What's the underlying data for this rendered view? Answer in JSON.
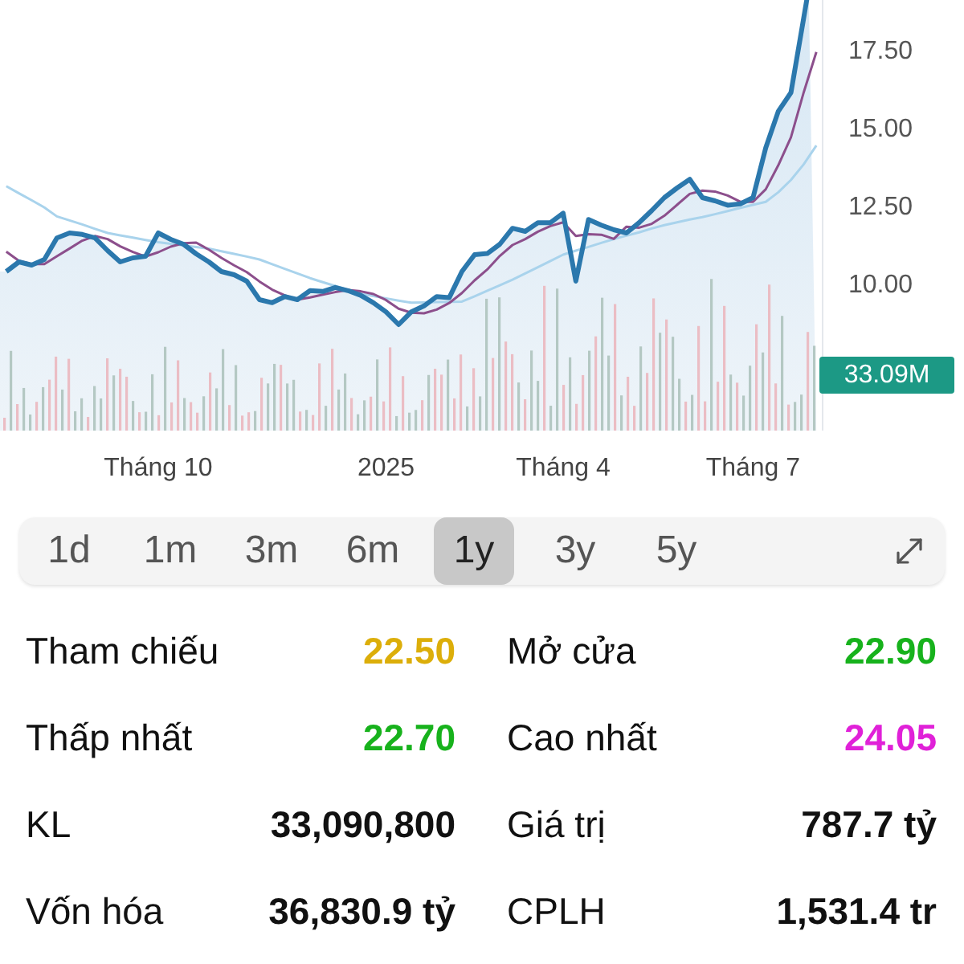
{
  "chart": {
    "volume_badge": "33.09M",
    "chart_data": {
      "type": "line",
      "ylim": [
        5.26,
        19.07
      ],
      "categories": [
        null,
        null,
        null,
        null,
        null,
        null,
        null,
        null,
        null,
        null,
        null,
        null,
        "Tháng 10",
        null,
        null,
        null,
        null,
        null,
        null,
        null,
        null,
        null,
        null,
        null,
        null,
        null,
        null,
        null,
        null,
        null,
        "2025",
        null,
        null,
        null,
        null,
        null,
        null,
        null,
        null,
        null,
        null,
        null,
        null,
        null,
        "Tháng 4",
        null,
        null,
        null,
        null,
        null,
        null,
        null,
        null,
        null,
        null,
        null,
        null,
        null,
        null,
        "Tháng 7",
        null,
        null,
        null,
        null,
        null
      ],
      "yticks": [
        {
          "value": 10,
          "label": "10.00"
        },
        {
          "value": 12.5,
          "label": "12.50"
        },
        {
          "value": 15,
          "label": "15.00"
        },
        {
          "value": 17.5,
          "label": "17.50"
        }
      ],
      "series": [
        {
          "color": "#a9d3ec",
          "values": [
            13.1,
            12.87,
            12.65,
            12.42,
            12.13,
            12.0,
            11.87,
            11.73,
            11.6,
            11.52,
            11.45,
            11.37,
            11.3,
            11.25,
            11.2,
            11.15,
            11.1,
            11.01,
            10.93,
            10.84,
            10.75,
            10.6,
            10.45,
            10.3,
            10.15,
            10.02,
            9.9,
            9.77,
            9.65,
            9.58,
            9.5,
            9.43,
            9.36,
            9.37,
            9.38,
            9.39,
            9.4,
            9.57,
            9.75,
            9.92,
            10.1,
            10.3,
            10.5,
            10.7,
            10.9,
            11.03,
            11.15,
            11.28,
            11.4,
            11.51,
            11.62,
            11.74,
            11.85,
            11.94,
            12.03,
            12.11,
            12.2,
            12.3,
            12.4,
            12.5,
            12.6,
            12.9,
            13.3,
            13.8,
            14.4
          ]
        },
        {
          "color": "#8c4f8c",
          "values": [
            11.0,
            10.7,
            10.6,
            10.6,
            10.85,
            11.1,
            11.35,
            11.5,
            11.4,
            11.17,
            10.99,
            10.84,
            10.98,
            11.16,
            11.27,
            11.29,
            11.06,
            10.8,
            10.56,
            10.34,
            10.04,
            9.78,
            9.6,
            9.46,
            9.53,
            9.62,
            9.7,
            9.77,
            9.73,
            9.64,
            9.45,
            9.17,
            9.04,
            9.02,
            9.14,
            9.35,
            9.67,
            10.08,
            10.43,
            10.86,
            11.21,
            11.4,
            11.64,
            11.82,
            11.94,
            11.5,
            11.56,
            11.54,
            11.41,
            11.8,
            11.77,
            11.89,
            12.15,
            12.5,
            12.85,
            12.96,
            12.93,
            12.8,
            12.6,
            12.6,
            13.0,
            13.77,
            14.67,
            16.1,
            17.4
          ]
        },
        {
          "color": "#2b78ad",
          "values": [
            10.36,
            10.67,
            10.57,
            10.75,
            11.44,
            11.6,
            11.55,
            11.44,
            11.03,
            10.67,
            10.8,
            10.85,
            11.6,
            11.39,
            11.24,
            10.93,
            10.67,
            10.36,
            10.26,
            10.05,
            9.46,
            9.36,
            9.56,
            9.46,
            9.75,
            9.72,
            9.85,
            9.75,
            9.6,
            9.36,
            9.07,
            8.66,
            9.07,
            9.26,
            9.56,
            9.52,
            10.36,
            10.9,
            10.94,
            11.24,
            11.75,
            11.65,
            11.93,
            11.93,
            12.23,
            10.05,
            12.03,
            11.85,
            11.7,
            11.6,
            11.93,
            12.32,
            12.73,
            13.04,
            13.32,
            12.73,
            12.63,
            12.49,
            12.53,
            12.73,
            14.33,
            15.5,
            16.1,
            18.48,
            null
          ]
        }
      ]
    }
  },
  "timeframes": [
    {
      "label": "1d",
      "selected": false
    },
    {
      "label": "1m",
      "selected": false
    },
    {
      "label": "3m",
      "selected": false
    },
    {
      "label": "6m",
      "selected": false
    },
    {
      "label": "1y",
      "selected": true
    },
    {
      "label": "3y",
      "selected": false
    },
    {
      "label": "5y",
      "selected": false
    }
  ],
  "stats": [
    {
      "label": "Tham chiếu",
      "value": "22.50",
      "color": "#dcae0a"
    },
    {
      "label": "Mở cửa",
      "value": "22.90",
      "color": "#17b21c"
    },
    {
      "label": "Thấp nhất",
      "value": "22.70",
      "color": "#17b21c"
    },
    {
      "label": "Cao nhất",
      "value": "24.05",
      "color": "#e021d8"
    },
    {
      "label": "KL",
      "value": "33,090,800",
      "color": "#111111"
    },
    {
      "label": "Giá trị",
      "value": "787.7 tỷ",
      "color": "#111111"
    },
    {
      "label": "Vốn hóa",
      "value": "36,830.9 tỷ",
      "color": "#111111"
    },
    {
      "label": "CPLH",
      "value": "1,531.4 tr",
      "color": "#111111"
    }
  ]
}
